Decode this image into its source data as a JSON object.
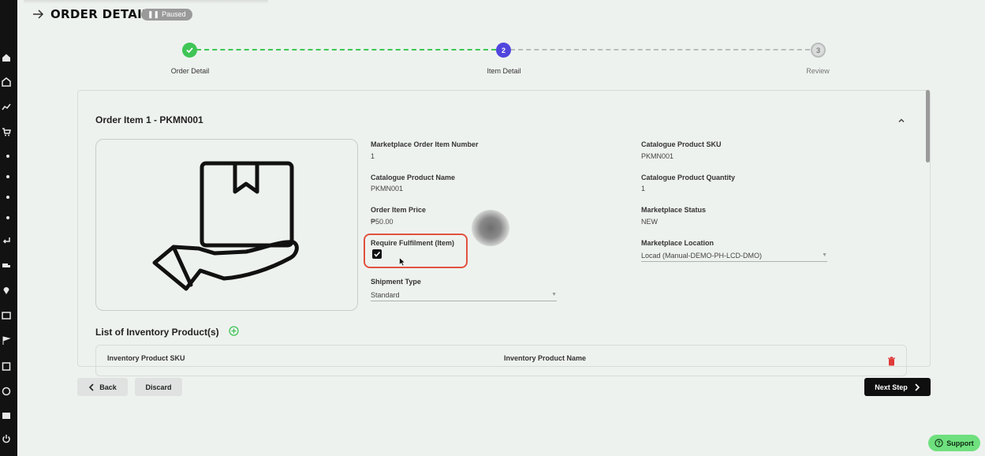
{
  "header": {
    "title": "ORDER DETAIL",
    "status": "Paused"
  },
  "stepper": {
    "steps": [
      {
        "number": "1",
        "label": "Order Detail",
        "state": "done"
      },
      {
        "number": "2",
        "label": "Item Detail",
        "state": "active"
      },
      {
        "number": "3",
        "label": "Review",
        "state": "todo"
      }
    ]
  },
  "item": {
    "title": "Order Item 1 - PKMN001",
    "marketplace_order_item_number": {
      "label": "Marketplace Order Item Number",
      "value": "1"
    },
    "catalogue_product_sku": {
      "label": "Catalogue Product SKU",
      "value": "PKMN001"
    },
    "catalogue_product_name": {
      "label": "Catalogue Product Name",
      "value": "PKMN001"
    },
    "catalogue_product_quantity": {
      "label": "Catalogue Product Quantity",
      "value": "1"
    },
    "order_item_price": {
      "label": "Order Item Price",
      "value": "₱50.00"
    },
    "marketplace_status": {
      "label": "Marketplace Status",
      "value": "NEW"
    },
    "require_fulfilment": {
      "label": "Require Fulfilment (Item)",
      "checked": true
    },
    "marketplace_location": {
      "label": "Marketplace Location",
      "value": "Locad (Manual-DEMO-PH-LCD-DMO)"
    },
    "shipment_type": {
      "label": "Shipment Type",
      "value": "Standard"
    }
  },
  "inventory": {
    "title": "List of Inventory Product(s)",
    "columns": [
      "Inventory Product SKU",
      "Inventory Product Name"
    ]
  },
  "footer": {
    "back_label": "Back",
    "discard_label": "Discard",
    "next_label": "Next Step"
  },
  "support_label": "Support",
  "colors": {
    "accent_green": "#3fc555",
    "active_step": "#5046dd",
    "highlight": "#e2513f",
    "support": "#6fe07e"
  }
}
